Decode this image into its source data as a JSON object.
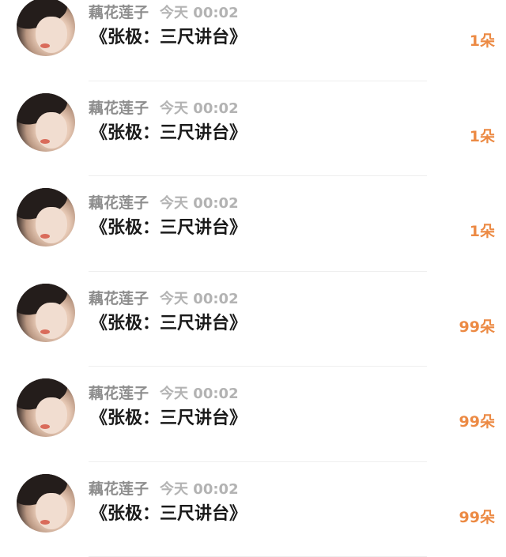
{
  "gifts": [
    {
      "user": "藕花莲子",
      "day": "今天",
      "time": "00:02",
      "title": "《张极：三尺讲台》",
      "amount": "1朵"
    },
    {
      "user": "藕花莲子",
      "day": "今天",
      "time": "00:02",
      "title": "《张极：三尺讲台》",
      "amount": "1朵"
    },
    {
      "user": "藕花莲子",
      "day": "今天",
      "time": "00:02",
      "title": "《张极：三尺讲台》",
      "amount": "1朵"
    },
    {
      "user": "藕花莲子",
      "day": "今天",
      "time": "00:02",
      "title": "《张极：三尺讲台》",
      "amount": "99朵"
    },
    {
      "user": "藕花莲子",
      "day": "今天",
      "time": "00:02",
      "title": "《张极：三尺讲台》",
      "amount": "99朵"
    },
    {
      "user": "藕花莲子",
      "day": "今天",
      "time": "00:02",
      "title": "《张极：三尺讲台》",
      "amount": "99朵"
    }
  ],
  "colors": {
    "amount": "#ec8a44",
    "title": "#1a1a1a",
    "meta": "#9c9c9c"
  }
}
